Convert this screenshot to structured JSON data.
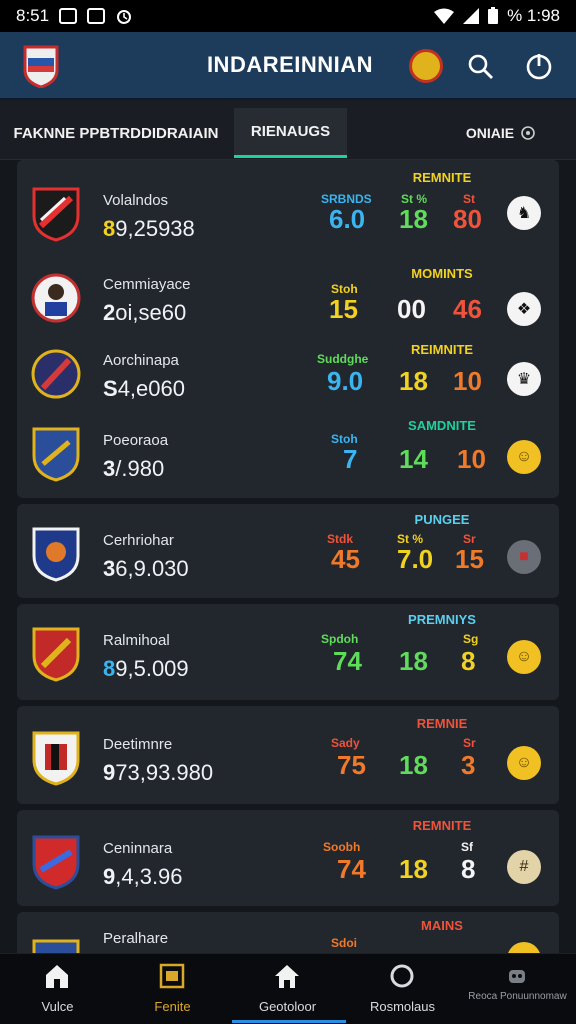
{
  "status_bar": {
    "time": "8:51",
    "battery": "% 1:98",
    "icons": [
      "gallery-icon",
      "k-icon",
      "alarm-icon",
      "wifi-icon",
      "signal-icon",
      "battery-icon"
    ]
  },
  "app_bar": {
    "title": "INDAREINNIAN",
    "icons": [
      "shield-logo",
      "badge-icon",
      "search-icon",
      "power-icon"
    ]
  },
  "tabs": {
    "main": "FAKNNE PPBTRDDIDRAIAIN",
    "active": "RIENAUGS",
    "right": "ONIAIE"
  },
  "colors": {
    "teal": "#1fd0a0",
    "blue": "#3ab5f0",
    "yellow": "#f1d221",
    "green": "#5fdc5a",
    "red": "#f0533a",
    "orange": "#f07a2a",
    "cyan": "#5ad0f0",
    "white": "#f4f4f4"
  },
  "rows": [
    {
      "name": "Volalndos",
      "value_lead": "8",
      "value_rest": "9,25938",
      "header": "REMNITE",
      "s1_label": "SRBNDS",
      "s1_value": "6.0",
      "s2_label": "St %",
      "s2_value": "18",
      "s3_label": "St",
      "s3_value": "80",
      "action_icon": "horse-icon"
    },
    {
      "name": "Cemmiayace",
      "value_lead": "2",
      "value_rest": "oi,se60",
      "header": "MOMINTS",
      "s1_label": "Stoh",
      "s1_value": "15",
      "s2_label": "",
      "s2_value": "00",
      "s3_label": "",
      "s3_value": "46",
      "action_icon": "boot-icon"
    },
    {
      "name": "Aorchinapa",
      "value_lead": "S",
      "value_rest": "4,e060",
      "header": "REIMNITE",
      "s1_label": "Suddghe",
      "s1_value": "9.0",
      "s2_label": "",
      "s2_value": "18",
      "s3_label": "",
      "s3_value": "10",
      "action_icon": "shoe-icon"
    },
    {
      "name": "Poeoraoa",
      "value_lead": "3",
      "value_rest": "/.980",
      "header": "SAMDNITE",
      "s1_label": "Stoh",
      "s1_value": "7",
      "s2_label": "",
      "s2_value": "14",
      "s3_label": "",
      "s3_value": "10",
      "action_icon": "smile-icon"
    },
    {
      "name": "Cerhriohar",
      "value_lead": "3",
      "value_rest": "6,9.030",
      "header": "PUNGEE",
      "s1_label": "Stdk",
      "s1_value": "45",
      "s2_label": "St %",
      "s2_value": "7.0",
      "s3_label": "Sr",
      "s3_value": "15",
      "action_icon": "flag-icon"
    },
    {
      "name": "Ralmihoal",
      "value_lead": "8",
      "value_rest": "9,5.009",
      "header": "PREMNIYS",
      "s1_label": "Spdoh",
      "s1_value": "74",
      "s2_label": "",
      "s2_value": "18",
      "s3_label": "Sg",
      "s3_value": "8",
      "action_icon": "smile-icon"
    },
    {
      "name": "Deetimnre",
      "value_lead": "9",
      "value_rest": "73,93.980",
      "header": "REMNIE",
      "s1_label": "Sady",
      "s1_value": "75",
      "s2_label": "",
      "s2_value": "18",
      "s3_label": "Sr",
      "s3_value": "3",
      "action_icon": "smile-icon"
    },
    {
      "name": "Ceninnara",
      "value_lead": "9",
      "value_rest": ",4,3.96",
      "header": "REMNITE",
      "s1_label": "Soobh",
      "s1_value": "74",
      "s2_label": "",
      "s2_value": "18",
      "s3_label": "Sf",
      "s3_value": "8",
      "action_icon": "hash-icon"
    },
    {
      "name": "Peralhare",
      "value_lead": "",
      "value_rest": "",
      "header": "MAINS",
      "s1_label": "Sdoi",
      "s1_value": "",
      "s2_label": "",
      "s2_value": "",
      "s3_label": "",
      "s3_value": "",
      "action_icon": "smile-icon"
    }
  ],
  "nav": [
    {
      "label": "Vulce",
      "icon": "home-icon"
    },
    {
      "label": "Fenite",
      "icon": "image-icon"
    },
    {
      "label": "Geotoloor",
      "icon": "house-icon"
    },
    {
      "label": "Rosmolaus",
      "icon": "ring-icon"
    },
    {
      "label": "Reoca Ponuunnomaw",
      "icon": "robot-icon"
    }
  ]
}
